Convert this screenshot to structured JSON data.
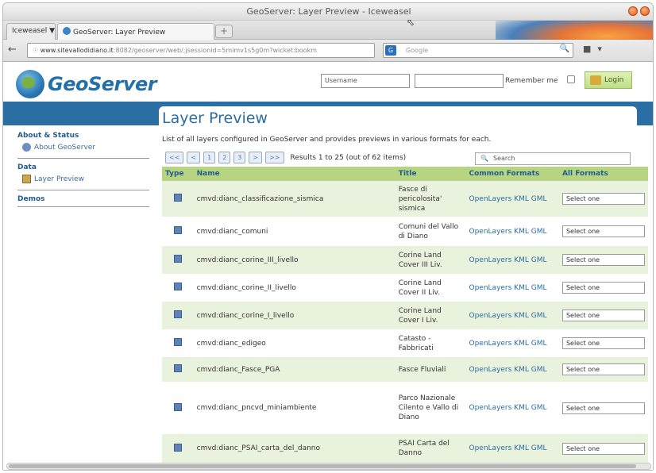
{
  "window": {
    "title": "GeoServer: Layer Preview - Iceweasel"
  },
  "tabs": [
    {
      "label": "Iceweasel ▼"
    },
    {
      "label": "GeoServer: Layer Preview"
    }
  ],
  "navbar": {
    "url_host": "www.sitevallodidiano.it",
    "url_path": ":8082/geoserver/web/;jsessionid=5mimv1s5g0m?wicket:bookm",
    "search_engine": "G",
    "search_placeholder": "Google"
  },
  "header": {
    "logo_text": "GeoServer",
    "username_placeholder": "Username",
    "password_value": "",
    "remember_label": "Remember me",
    "login_label": "Login"
  },
  "sidebar": {
    "sections": [
      {
        "heading": "About & Status",
        "items": [
          {
            "label": "About GeoServer",
            "icon": "info-icon"
          }
        ]
      },
      {
        "heading": "Data",
        "items": [
          {
            "label": "Layer Preview",
            "icon": "layer-preview-icon"
          }
        ]
      },
      {
        "heading": "Demos",
        "items": []
      }
    ]
  },
  "main": {
    "title": "Layer Preview",
    "description": "List of all layers configured in GeoServer and provides previews in various formats for each.",
    "pager": {
      "buttons": [
        "<<",
        "<",
        "1",
        "2",
        "3",
        ">",
        ">>"
      ],
      "results": "Results 1 to 25 (out of 62 items)"
    },
    "search_placeholder": "Search",
    "columns": [
      "Type",
      "Name",
      "Title",
      "Common Formats",
      "All Formats"
    ],
    "formats_text": "OpenLayers KML GML",
    "select_label": "Select one",
    "rows": [
      {
        "name": "cmvd:dianc_classificazione_sismica",
        "title": "Fasce di pericolosita' sismica"
      },
      {
        "name": "cmvd:dianc_comuni",
        "title": "Comuni del Vallo di Diano"
      },
      {
        "name": "cmvd:dianc_corine_III_livello",
        "title": "Corine Land Cover III Liv."
      },
      {
        "name": "cmvd:dianc_corine_II_livello",
        "title": "Corine Land Cover II Liv."
      },
      {
        "name": "cmvd:dianc_corine_I_livello",
        "title": "Corine Land Cover I Liv."
      },
      {
        "name": "cmvd:dianc_edigeo",
        "title": "Catasto - Fabbricati"
      },
      {
        "name": "cmvd:dianc_Fasce_PGA",
        "title": "Fasce Fluviali"
      },
      {
        "name": "cmvd:dianc_pncvd_miniambiente",
        "title": "Parco Nazionale Cilento e Vallo di Diano"
      },
      {
        "name": "cmvd:dianc_PSAI_carta_del_danno",
        "title": "PSAI Carta del Danno"
      }
    ]
  },
  "colors": {
    "brand_blue": "#2a6ea3",
    "header_green": "#b7d483",
    "row_green": "#e9f2dc"
  }
}
